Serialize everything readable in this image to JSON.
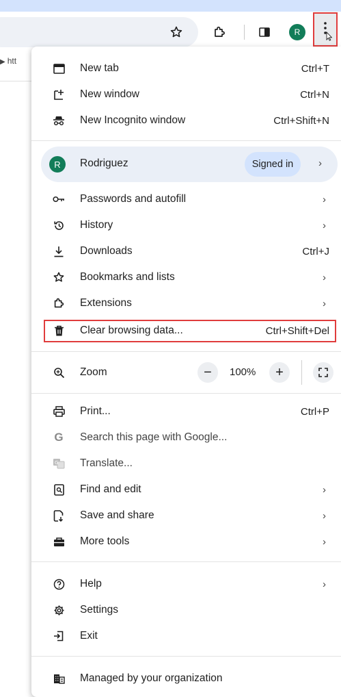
{
  "toolbar": {
    "url_fragment": "htt",
    "avatar_letter": "R",
    "icons": [
      "star-icon",
      "extensions-icon",
      "side-panel-icon",
      "kebab-menu-icon"
    ]
  },
  "menu": {
    "new_tab": {
      "label": "New tab",
      "shortcut": "Ctrl+T"
    },
    "new_window": {
      "label": "New window",
      "shortcut": "Ctrl+N"
    },
    "incognito": {
      "label": "New Incognito window",
      "shortcut": "Ctrl+Shift+N"
    },
    "profile": {
      "avatar_letter": "R",
      "name": "Rodriguez",
      "status": "Signed in",
      "chevron": "›"
    },
    "passwords": {
      "label": "Passwords and autofill",
      "chevron": "›"
    },
    "history": {
      "label": "History",
      "chevron": "›"
    },
    "downloads": {
      "label": "Downloads",
      "shortcut": "Ctrl+J"
    },
    "bookmarks": {
      "label": "Bookmarks and lists",
      "chevron": "›"
    },
    "extensions": {
      "label": "Extensions",
      "chevron": "›"
    },
    "clear_data": {
      "label": "Clear browsing data...",
      "shortcut": "Ctrl+Shift+Del"
    },
    "zoom": {
      "label": "Zoom",
      "minus": "−",
      "value": "100%",
      "plus": "+"
    },
    "print": {
      "label": "Print...",
      "shortcut": "Ctrl+P"
    },
    "search_google": {
      "label": "Search this page with Google..."
    },
    "translate": {
      "label": "Translate..."
    },
    "find_edit": {
      "label": "Find and edit",
      "chevron": "›"
    },
    "save_share": {
      "label": "Save and share",
      "chevron": "›"
    },
    "more_tools": {
      "label": "More tools",
      "chevron": "›"
    },
    "help": {
      "label": "Help",
      "chevron": "›"
    },
    "settings": {
      "label": "Settings"
    },
    "exit": {
      "label": "Exit"
    },
    "managed": {
      "label": "Managed by your organization"
    }
  },
  "colors": {
    "accent_blue": "#d3e3fd",
    "avatar_green": "#127d59",
    "highlight_red": "#e03c3c"
  }
}
